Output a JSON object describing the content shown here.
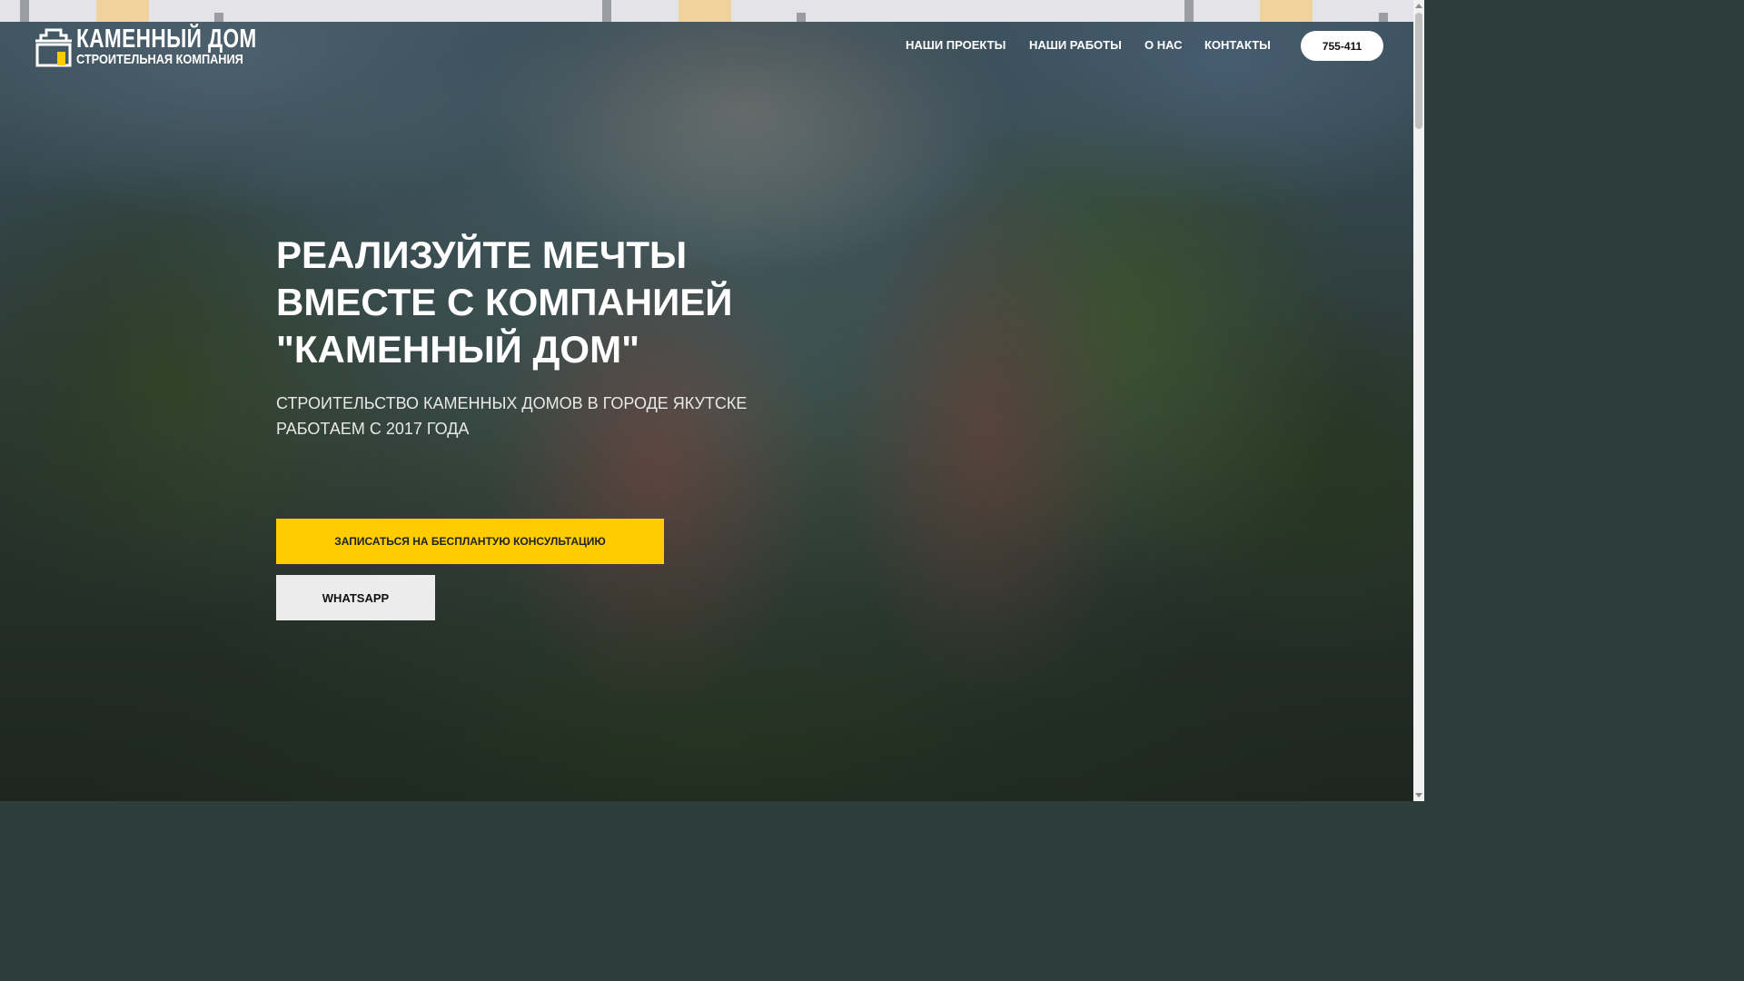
{
  "brand": {
    "name": "КАМЕННЫЙ ДОМ",
    "tagline": "СТРОИТЕЛЬНАЯ КОМПАНИЯ",
    "accent_color": "#ffcc00"
  },
  "nav": {
    "items": [
      {
        "label": "НАШИ ПРОЕКТЫ"
      },
      {
        "label": "НАШИ РАБОТЫ"
      },
      {
        "label": "О НАС"
      },
      {
        "label": "КОНТАКТЫ"
      }
    ],
    "phone": "755-411"
  },
  "hero": {
    "title_lines": [
      "РЕАЛИЗУЙТЕ МЕЧТЫ",
      "ВМЕСТЕ С КОМПАНИЕЙ",
      "\"КАМЕННЫЙ ДОМ\""
    ],
    "subtitle_lines": [
      "СТРОИТЕЛЬСТВО КАМЕННЫХ ДОМОВ В ГОРОДЕ ЯКУТСКЕ",
      "РАБОТАЕМ С 2017 ГОДА"
    ],
    "primary_button": "ЗАПИСАТЬСЯ НА БЕСПЛАНТУЮ КОНСУЛЬТАЦИЮ",
    "secondary_button": "WHATSAPP"
  },
  "icons": {
    "logo": "castle-house-icon"
  }
}
